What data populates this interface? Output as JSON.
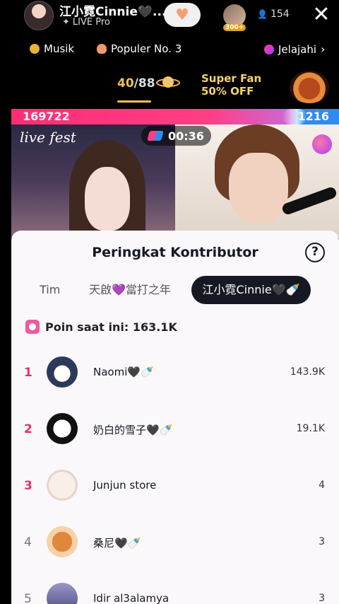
{
  "header": {
    "host_name": "江小霓Cinnie🖤...",
    "host_subtitle": "LIVE Pro",
    "viewer_badge": "300+",
    "viewer_count": "154"
  },
  "categories": [
    {
      "label": "Musik"
    },
    {
      "label": "Populer No. 3"
    },
    {
      "label": "Jelajahi"
    }
  ],
  "progress": {
    "current": "40",
    "total": "/88"
  },
  "superfan": {
    "line1": "Super Fan",
    "line2": "50% OFF"
  },
  "battle": {
    "left_score": "169722",
    "right_score": "1216"
  },
  "video": {
    "overlay_text": "live fest",
    "timer": "00:36"
  },
  "sheet": {
    "title": "Peringkat Kontributor",
    "tabs": [
      "Tim",
      "天啟💜當打之年",
      "江小霓Cinnie🖤🍼"
    ],
    "points_label": "Poin saat ini: 163.1K",
    "contributors": [
      {
        "rank": "1",
        "name": "Naomi🖤🍼",
        "score": "143.9K"
      },
      {
        "rank": "2",
        "name": "奶白的雪子🖤🍼",
        "score": "19.1K"
      },
      {
        "rank": "3",
        "name": "Junjun store",
        "score": "4"
      },
      {
        "rank": "4",
        "name": "桑尼🖤🍼",
        "score": "3"
      },
      {
        "rank": "5",
        "name": "Idir al3alamya",
        "score": "3"
      }
    ]
  },
  "colors": {
    "accent_pink": "#ff2d75",
    "accent_blue": "#2e8cf0",
    "gold": "#f0c24f"
  },
  "icons": [
    "close-icon",
    "heart-plus-icon",
    "person-icon",
    "chevron-right-icon",
    "help-icon",
    "clock-icon",
    "planet-icon"
  ]
}
